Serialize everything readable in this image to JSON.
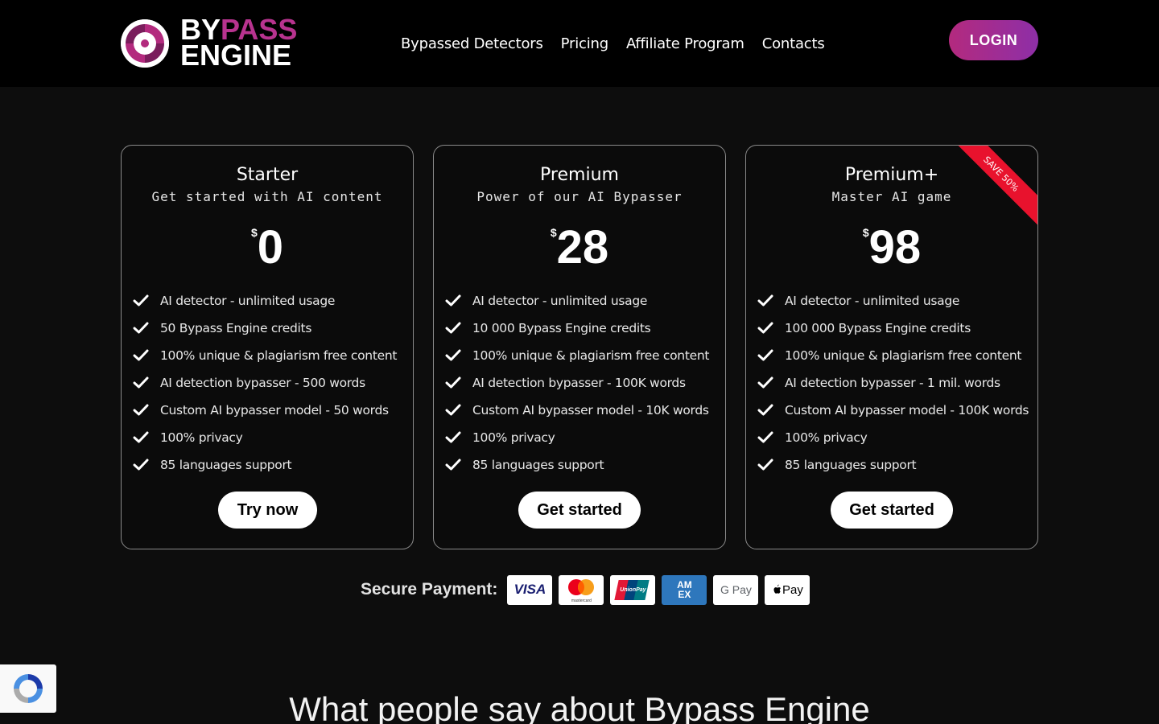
{
  "header": {
    "logo": {
      "line1_white": "BY",
      "line1_pink": "PASS",
      "line2": "ENGINE"
    },
    "nav": [
      "Bypassed Detectors",
      "Pricing",
      "Affiliate Program",
      "Contacts"
    ],
    "login_label": "LOGIN"
  },
  "plans": [
    {
      "title": "Starter",
      "subtitle": "Get started with AI content",
      "currency": "$",
      "price": "0",
      "features": [
        "AI detector - unlimited usage",
        "50 Bypass Engine credits",
        "100% unique & plagiarism free content",
        "AI detection bypasser - 500 words",
        "Custom AI bypasser model - 50 words",
        "100% privacy",
        "85 languages support"
      ],
      "cta": "Try now"
    },
    {
      "title": "Premium",
      "subtitle": "Power of our AI Bypasser",
      "currency": "$",
      "price": "28",
      "features": [
        "AI detector - unlimited usage",
        "10 000 Bypass Engine credits",
        "100% unique & plagiarism free content",
        "AI detection bypasser - 100K words",
        "Custom AI bypasser model - 10K words",
        "100% privacy",
        "85 languages support"
      ],
      "cta": "Get started"
    },
    {
      "title": "Premium+",
      "subtitle": "Master AI game",
      "currency": "$",
      "price": "98",
      "ribbon": "SAVE 50%",
      "features": [
        "AI detector - unlimited usage",
        "100 000 Bypass Engine credits",
        "100% unique & plagiarism free content",
        "AI detection bypasser - 1 mil. words",
        "Custom AI bypasser model - 100K words",
        "100% privacy",
        "85 languages support"
      ],
      "cta": "Get started"
    }
  ],
  "payment": {
    "label": "Secure Payment:",
    "methods": [
      {
        "name": "visa",
        "text": "VISA"
      },
      {
        "name": "mastercard",
        "text": "mastercard"
      },
      {
        "name": "unionpay",
        "text": "UnionPay"
      },
      {
        "name": "amex",
        "text": "AM EX"
      },
      {
        "name": "google-pay",
        "text": "G Pay"
      },
      {
        "name": "apple-pay",
        "text": "Pay"
      }
    ]
  },
  "testimonials": {
    "heading": "What people say about Bypass Engine"
  },
  "colors": {
    "accent_pink": "#b32a7e",
    "accent_purple": "#8e2fa7",
    "ribbon_red": "#e8122d",
    "background": "#0d0d0d"
  }
}
